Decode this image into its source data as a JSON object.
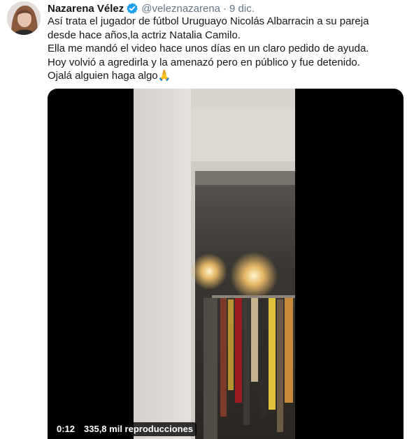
{
  "tweet": {
    "author_name": "Nazarena Vélez",
    "handle": "@veleznazarena",
    "separator": "·",
    "date": "9 dic.",
    "lines": [
      "Así trata el jugador de fútbol Uruguayo Nicolás Albarracin a su pareja",
      "desde hace años,la actriz Natalia Camilo.",
      "Ella me mandó el video hace unos días en un claro pedido de ayuda.",
      "Hoy volvió a agredirla y la amenazó pero en público y fue detenido.",
      "Ojalá alguien haga algo🙏"
    ]
  },
  "video": {
    "elapsed": "0:12",
    "views": "335,8 mil reproducciones"
  },
  "icons": {
    "verified": "verified-badge-icon",
    "avatar": "profile-avatar"
  },
  "colors": {
    "verified": "#1da1f2",
    "secondary_text": "#657786",
    "primary_text": "#14171a",
    "video_bg": "#000000"
  }
}
